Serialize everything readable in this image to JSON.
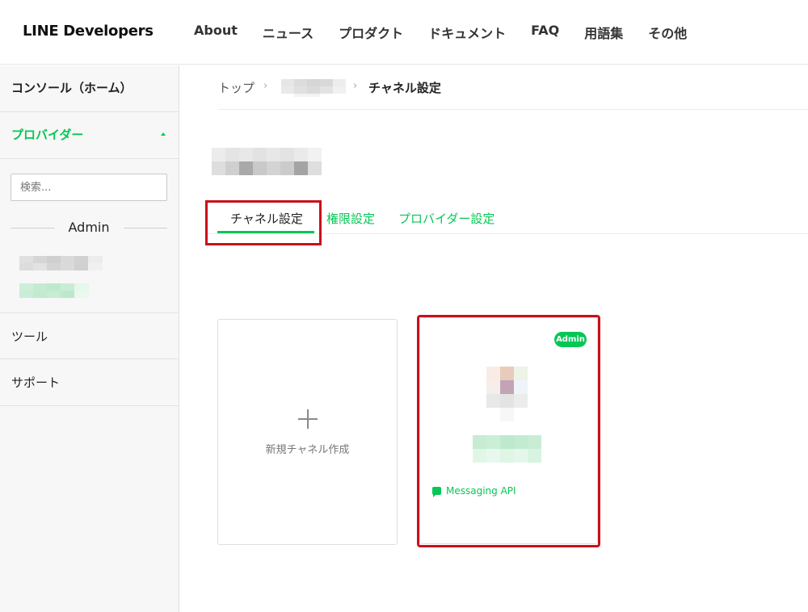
{
  "header": {
    "logo": "LINE Developers",
    "nav": [
      "About",
      "ニュース",
      "プロダクト",
      "ドキュメント",
      "FAQ",
      "用語集",
      "その他"
    ]
  },
  "sidebar": {
    "console": "コンソール（ホーム）",
    "provider": "プロバイダー",
    "search_placeholder": "検索...",
    "admin_heading": "Admin",
    "tools": "ツール",
    "support": "サポート"
  },
  "breadcrumb": {
    "top": "トップ",
    "current": "チャネル設定"
  },
  "tabs": {
    "channel": "チャネル設定",
    "permissions": "権限設定",
    "provider": "プロバイダー設定"
  },
  "cards": {
    "new_channel": "新規チャネル作成",
    "channel_badge": "Admin",
    "channel_type": "Messaging API"
  },
  "colors": {
    "accent": "#06c755",
    "highlight": "#c8101c"
  }
}
